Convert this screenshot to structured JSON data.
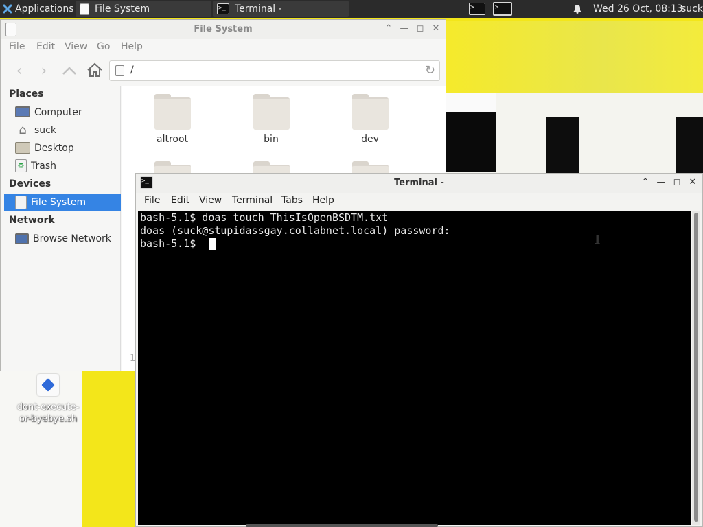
{
  "panel": {
    "applications_label": "Applications",
    "tasks": [
      {
        "label": "File System"
      },
      {
        "label": "Terminal -"
      }
    ],
    "clock": "Wed 26 Oct, 08:13",
    "user": "suck"
  },
  "file_manager": {
    "title": "File System",
    "menu": [
      "File",
      "Edit",
      "View",
      "Go",
      "Help"
    ],
    "location": "/",
    "sidebar": {
      "places_header": "Places",
      "places": [
        {
          "label": "Computer",
          "icon": "computer-icon"
        },
        {
          "label": "suck",
          "icon": "home-icon"
        },
        {
          "label": "Desktop",
          "icon": "desktop-icon"
        },
        {
          "label": "Trash",
          "icon": "trash-icon"
        }
      ],
      "devices_header": "Devices",
      "devices": [
        {
          "label": "File System",
          "icon": "drive-icon",
          "selected": true
        }
      ],
      "network_header": "Network",
      "network": [
        {
          "label": "Browse Network",
          "icon": "network-icon"
        }
      ]
    },
    "folders": [
      "altroot",
      "bin",
      "dev"
    ],
    "status_fragment": "1"
  },
  "desktop": {
    "file_label_line1": "dont-execute-",
    "file_label_line2": "or-byebye.sh"
  },
  "terminal": {
    "title": "Terminal -",
    "menu": [
      "File",
      "Edit",
      "View",
      "Terminal",
      "Tabs",
      "Help"
    ],
    "lines": [
      "bash-5.1$ doas touch ThisIsOpenBSDTM.txt",
      "doas (suck@stupidassgay.collabnet.local) password:",
      "bash-5.1$ "
    ]
  },
  "colors": {
    "panel_bg": "#2b2b2b",
    "selection": "#3584e4",
    "terminal_bg": "#000000",
    "desktop_yellow": "#f3e61a"
  }
}
